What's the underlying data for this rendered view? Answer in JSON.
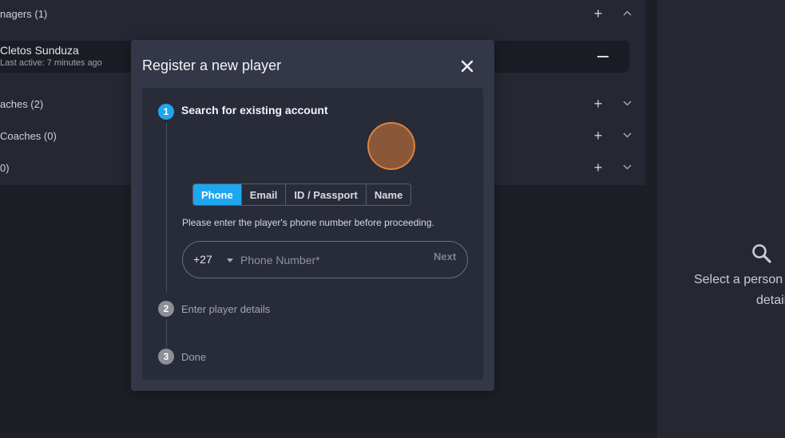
{
  "background_list": {
    "rows": [
      {
        "label": "nagers (1)",
        "chevron": "chevron-up"
      },
      {
        "label": "aches (2)",
        "chevron": "chevron-down"
      },
      {
        "label": " Coaches (0)",
        "chevron": "chevron-down"
      },
      {
        "label": "0)",
        "chevron": "chevron-down"
      }
    ],
    "member": {
      "name": "Cletos Sunduza",
      "subtitle": "Last active: 7 minutes ago"
    }
  },
  "right_panel": {
    "icon": "search-icon",
    "line1": "Select a person t",
    "line2": "details"
  },
  "modal": {
    "title": "Register a new player",
    "close_icon": "close-icon",
    "steps": [
      {
        "number": "1",
        "label": "Search for existing account",
        "state": "active"
      },
      {
        "number": "2",
        "label": "Enter player details",
        "state": "inactive"
      },
      {
        "number": "3",
        "label": "Done",
        "state": "inactive"
      }
    ],
    "search_tabs": [
      "Phone",
      "Email",
      "ID / Passport",
      "Name"
    ],
    "selected_tab": "Phone",
    "hint": "Please enter the player's phone number before proceeding.",
    "phone": {
      "country_code": "+27",
      "value": "",
      "placeholder": "Phone Number*"
    },
    "next_label": "Next"
  },
  "colors": {
    "accent": "#1ea7f0",
    "modal_bg": "#333748",
    "page_bg": "#1d1f27",
    "click_indicator": "#da7c38"
  }
}
